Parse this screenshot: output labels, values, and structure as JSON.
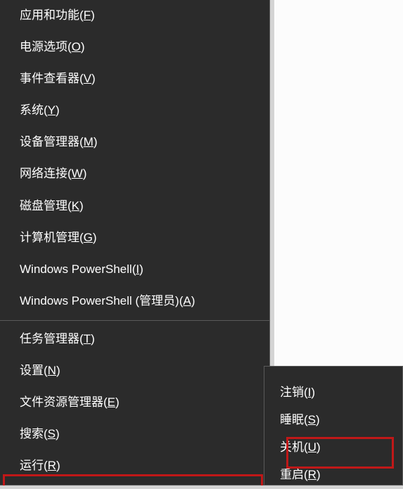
{
  "menu": {
    "group1": [
      {
        "label": "应用和功能",
        "accel": "F"
      },
      {
        "label": "电源选项",
        "accel": "O"
      },
      {
        "label": "事件查看器",
        "accel": "V"
      },
      {
        "label": "系统",
        "accel": "Y"
      },
      {
        "label": "设备管理器",
        "accel": "M"
      },
      {
        "label": "网络连接",
        "accel": "W"
      },
      {
        "label": "磁盘管理",
        "accel": "K"
      },
      {
        "label": "计算机管理",
        "accel": "G"
      },
      {
        "label": "Windows PowerShell",
        "accel": "I"
      },
      {
        "label": "Windows PowerShell (管理员)",
        "accel": "A"
      }
    ],
    "group2": [
      {
        "label": "任务管理器",
        "accel": "T"
      },
      {
        "label": "设置",
        "accel": "N"
      },
      {
        "label": "文件资源管理器",
        "accel": "E"
      },
      {
        "label": "搜索",
        "accel": "S"
      },
      {
        "label": "运行",
        "accel": "R"
      }
    ]
  },
  "submenu": {
    "items": [
      {
        "label": "注销",
        "accel": "I"
      },
      {
        "label": "睡眠",
        "accel": "S"
      },
      {
        "label": "关机",
        "accel": "U"
      },
      {
        "label": "重启",
        "accel": "R"
      }
    ]
  },
  "highlighted_submenu_index": 2
}
